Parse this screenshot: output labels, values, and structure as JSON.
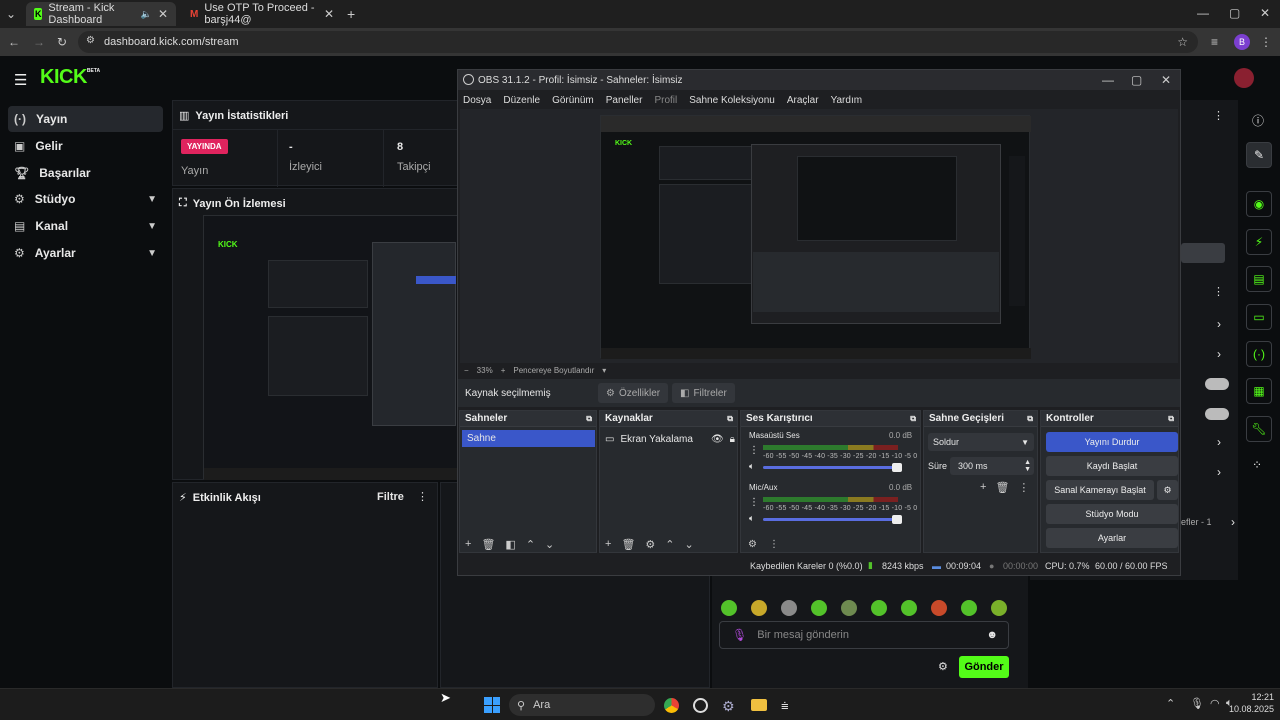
{
  "browser": {
    "tabs": [
      {
        "title": "Stream - Kick Dashboard"
      },
      {
        "title": "Use OTP To Proceed - barşj44@"
      }
    ],
    "url": "dashboard.kick.com/stream",
    "profile_initial": "B"
  },
  "kick": {
    "logo": "KICK",
    "logo_badge": "BETA",
    "sidebar": [
      {
        "label": "Yayın",
        "icon": "broadcast-icon"
      },
      {
        "label": "Gelir",
        "icon": "revenue-icon"
      },
      {
        "label": "Başarılar",
        "icon": "trophy-icon"
      },
      {
        "label": "Stüdyo",
        "icon": "studio-icon"
      },
      {
        "label": "Kanal",
        "icon": "channel-icon"
      },
      {
        "label": "Ayarlar",
        "icon": "settings-icon"
      }
    ],
    "stats": {
      "title": "Yayın İstatistikleri",
      "live_badge": "YAYINDA",
      "live_label": "Yayın",
      "viewers_value": "-",
      "viewers_label": "İzleyici",
      "followers_value": "8",
      "followers_label": "Takipçi"
    },
    "preview_title": "Yayın Ön İzlemesi",
    "activity": {
      "title": "Etkinlik Akışı",
      "filter": "Filtre"
    },
    "chat": {
      "placeholder": "Bir mesaj gönderin",
      "send": "Gönder"
    },
    "partial_text": "efler - 1"
  },
  "obs": {
    "title": "OBS 31.1.2 - Profil: İsimsiz - Sahneler: İsimsiz",
    "menu": [
      "Dosya",
      "Düzenle",
      "Görünüm",
      "Paneller",
      "Profil",
      "Sahne Koleksiyonu",
      "Araçlar",
      "Yardım"
    ],
    "zoom": "33%",
    "fit_label": "Pencereye Boyutlandır",
    "no_source": "Kaynak seçilmemiş",
    "properties": "Özellikler",
    "filters": "Filtreler",
    "scenes": {
      "title": "Sahneler",
      "items": [
        "Sahne"
      ]
    },
    "sources": {
      "title": "Kaynaklar",
      "items": [
        "Ekran Yakalama"
      ]
    },
    "mixer": {
      "title": "Ses Karıştırıcı",
      "ticks": "-60 -55 -50 -45 -40 -35 -30 -25 -20 -15 -10 -5 0",
      "channels": [
        {
          "name": "Masaüstü Ses",
          "db": "0.0 dB"
        },
        {
          "name": "Mic/Aux",
          "db": "0.0 dB"
        }
      ]
    },
    "transitions": {
      "title": "Sahne Geçişleri",
      "type": "Soldur",
      "duration_label": "Süre",
      "duration": "300 ms"
    },
    "controls": {
      "title": "Kontroller",
      "buttons": [
        "Yayını Durdur",
        "Kaydı Başlat",
        "Sanal Kamerayı Başlat",
        "Stüdyo Modu",
        "Ayarlar"
      ]
    },
    "status": {
      "dropped": "Kaybedilen Kareler 0 (%0.0)",
      "kbps": "8243 kbps",
      "stream_time": "00:09:04",
      "rec_time": "00:00:00",
      "cpu": "CPU: 0.7%",
      "fps": "60.00 / 60.00 FPS"
    }
  },
  "taskbar": {
    "search": "Ara",
    "time": "12:21",
    "date": "10.08.2025"
  }
}
